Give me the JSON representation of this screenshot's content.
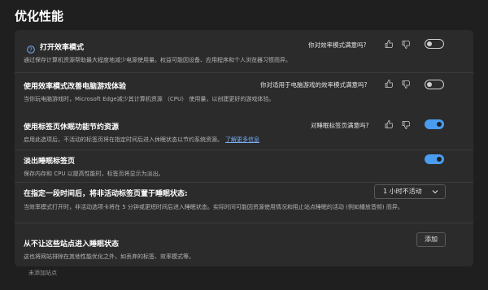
{
  "page": {
    "title": "优化性能"
  },
  "efficiency": {
    "title": "打开效率模式",
    "desc": "通过保存计算机资源帮助最大程度地减少电源使用量。权益可能因设备、应用程序和个人浏览器习惯而异。",
    "feedback": "你对效率模式满意吗?",
    "toggle": "off"
  },
  "gaming": {
    "title": "使用效率模式改善电脑游戏体验",
    "desc": "当你玩电脑游戏时，Microsoft Edge减少其计算机资源 （CPU） 使用量，以创建更好的游戏体验。",
    "feedback": "你对适用于电脑游戏的效率模式满意吗?",
    "toggle": "off"
  },
  "sleeping": {
    "title": "使用标签页休眠功能节约资源",
    "desc": "启用此选项后，不活动的标签页将在指定时间后进入休眠状态以节约系统资源。",
    "learn_more": "了解更多信息",
    "feedback": "对睡眠标签页满意吗?",
    "toggle": "on"
  },
  "fade": {
    "title": "淡出睡眠标签页",
    "desc": "保存内存和 CPU 以提高性能时，标签页将显示为淡出。",
    "toggle": "on"
  },
  "timeout": {
    "title": "在指定一段时间后，将非活动标签页置于睡眠状态:",
    "value": "1 小时不活动",
    "desc": "当效率模式打开时，非活动选项卡将在 5 分钟或更短时间后进入睡眠状态。实际时间可能因资源使用情况和阻止站点睡眠的活动 (例如播放音频) 而异。"
  },
  "never_sleep": {
    "title": "从不让这些站点进入睡眠状态",
    "desc": "这也将网站排除在其他性能优化之外，如丢弃的标签、效率模式等。",
    "add_label": "添加",
    "empty": "未添加站点"
  },
  "colors": {
    "accent": "#4a9cf0",
    "background": "#1f1f1f",
    "card": "#2b2b2b"
  },
  "icons": [
    "info-icon",
    "thumbs-up-icon",
    "thumbs-down-icon",
    "chevron-down-icon"
  ]
}
